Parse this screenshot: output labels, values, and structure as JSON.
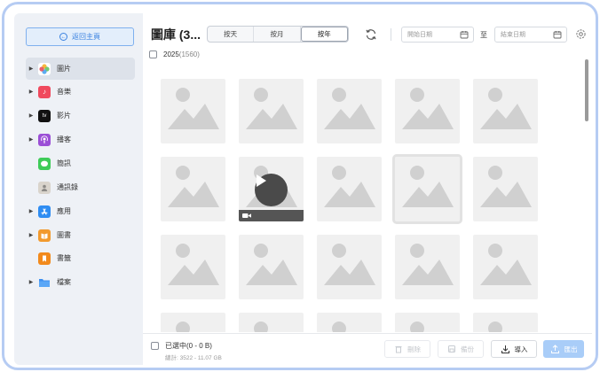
{
  "sidebar": {
    "back_button": "返回主頁",
    "items": [
      {
        "label": "圖片",
        "icon": "photos-icon",
        "expandable": true,
        "selected": true
      },
      {
        "label": "音樂",
        "icon": "music-icon",
        "expandable": true,
        "selected": false
      },
      {
        "label": "影片",
        "icon": "apple-tv-icon",
        "expandable": true,
        "selected": false
      },
      {
        "label": "播客",
        "icon": "podcast-icon",
        "expandable": true,
        "selected": false
      },
      {
        "label": "簡訊",
        "icon": "messages-icon",
        "expandable": false,
        "selected": false
      },
      {
        "label": "通訊錄",
        "icon": "contacts-icon",
        "expandable": false,
        "selected": false
      },
      {
        "label": "應用",
        "icon": "app-store-icon",
        "expandable": true,
        "selected": false
      },
      {
        "label": "圖書",
        "icon": "books-icon",
        "expandable": true,
        "selected": false
      },
      {
        "label": "書籤",
        "icon": "bookmark-icon",
        "expandable": false,
        "selected": false
      },
      {
        "label": "檔案",
        "icon": "folder-icon",
        "expandable": true,
        "selected": false
      }
    ]
  },
  "toolbar": {
    "title": "圖庫 (3...",
    "segments": [
      {
        "label": "按天",
        "active": false
      },
      {
        "label": "按月",
        "active": false
      },
      {
        "label": "按年",
        "active": true
      }
    ],
    "start_date_placeholder": "開始日期",
    "to_label": "至",
    "end_date_placeholder": "結束日期"
  },
  "group": {
    "year": "2025",
    "count": "(1560)"
  },
  "footer": {
    "selected": "已選中(0 - 0 B)",
    "total": "總計: 3522 - 11.07 GB",
    "delete_label": "刪除",
    "backup_label": "備份",
    "import_label": "導入",
    "export_label": "匯出"
  },
  "colors": {
    "accent": "#3b82e0",
    "sidebar_bg": "#eef1f6",
    "frame_border": "#b6ccf3",
    "export_button": "#a9cdf8"
  }
}
